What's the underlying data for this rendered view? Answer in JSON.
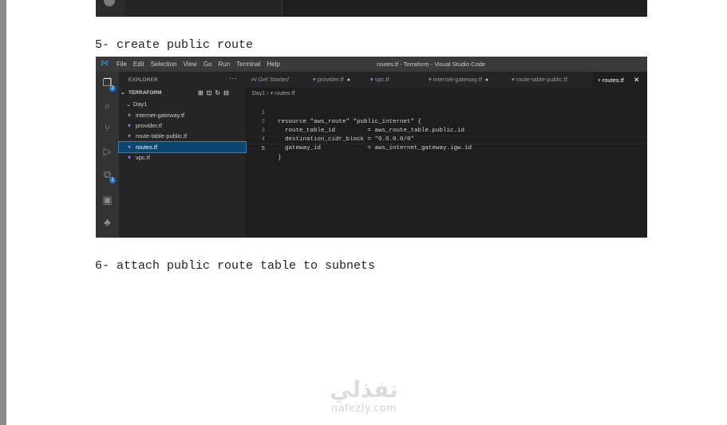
{
  "doc": {
    "heading_5": "5- create public route",
    "heading_6": "6- attach public route table to subnets"
  },
  "vscode": {
    "window_title": "routes.tf - Terraform - Visual Studio Code",
    "menu": [
      "File",
      "Edit",
      "Selection",
      "View",
      "Go",
      "Run",
      "Terminal",
      "Help"
    ],
    "activity_badges": {
      "explorer": "2",
      "extensions": "1"
    },
    "explorer": {
      "header": "EXPLORER",
      "project": "TERRAFORM",
      "folder": "Day1",
      "files": [
        "internet-gateway.tf",
        "provider.tf",
        "route-table-public.tf",
        "routes.tf",
        "vpc.tf"
      ],
      "selected_file": "routes.tf"
    },
    "tabs": [
      {
        "label": "Get Started"
      },
      {
        "label": "provider.tf",
        "modified": true
      },
      {
        "label": "vpc.tf"
      },
      {
        "label": "internet-gateway.tf",
        "modified": true
      },
      {
        "label": "route-table-public.tf"
      },
      {
        "label": "routes.tf",
        "active": true
      }
    ],
    "breadcrumb": {
      "folder": "Day1",
      "file": "routes.tf"
    },
    "code": [
      {
        "n": "1",
        "text": "resource \"aws_route\" \"public_internet\" {"
      },
      {
        "n": "2",
        "text": "  route_table_id         = aws_route_table.public.id"
      },
      {
        "n": "3",
        "text": "  destination_cidr_block = \"0.0.0.0/0\""
      },
      {
        "n": "4",
        "text": "  gateway_id             = aws_internet_gateway.igw.id"
      },
      {
        "n": "5",
        "text": "}"
      }
    ]
  },
  "watermark": {
    "logo": "نفذلي",
    "site": "nafezly.com"
  }
}
